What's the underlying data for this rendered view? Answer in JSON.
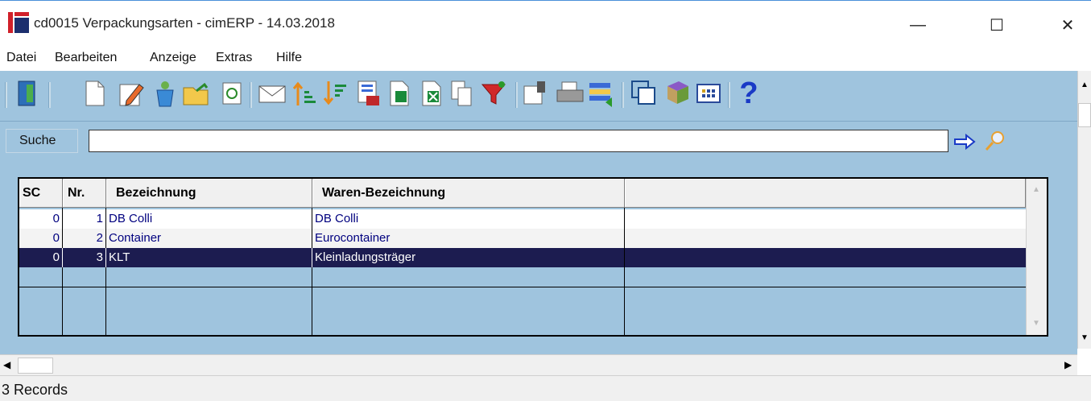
{
  "window": {
    "title": "cd0015 Verpackungsarten - cimERP - 14.03.2018",
    "minimize": "—",
    "maximize": "☐",
    "close": "✕"
  },
  "menu": {
    "items": [
      "Datei",
      "Bearbeiten",
      "Anzeige",
      "Extras",
      "Hilfe"
    ]
  },
  "toolbar": {
    "icons": [
      "exit-door-icon",
      "new-document-icon",
      "edit-pencil-icon",
      "recycle-icon",
      "open-folder-icon",
      "refresh-icon",
      "mail-icon",
      "sort-ascending-icon",
      "sort-descending-icon",
      "calculator-123-icon",
      "export-icon",
      "excel-icon",
      "copy-icon",
      "filter-funnel-icon",
      "properties-icon",
      "print-icon",
      "transfer-icon",
      "windows-icon",
      "book-icon",
      "grid-icon",
      "help-icon"
    ],
    "help_glyph": "?"
  },
  "search": {
    "label": "Suche",
    "value": "",
    "placeholder": ""
  },
  "grid": {
    "columns": [
      "SC",
      "Nr.",
      "Bezeichnung",
      "Waren-Bezeichnung",
      ""
    ],
    "rows": [
      {
        "sc": "0",
        "nr": "1",
        "bezeichnung": "DB Colli",
        "waren": "DB Colli",
        "selected": false
      },
      {
        "sc": "0",
        "nr": "2",
        "bezeichnung": "Container",
        "waren": "Eurocontainer",
        "selected": false
      },
      {
        "sc": "0",
        "nr": "3",
        "bezeichnung": "KLT",
        "waren": "Kleinladungsträger",
        "selected": true
      }
    ]
  },
  "status": {
    "text": "3 Records"
  },
  "colors": {
    "accent": "#9fc4de",
    "selected_row": "#1c1c50",
    "text_blue": "#00007f"
  }
}
